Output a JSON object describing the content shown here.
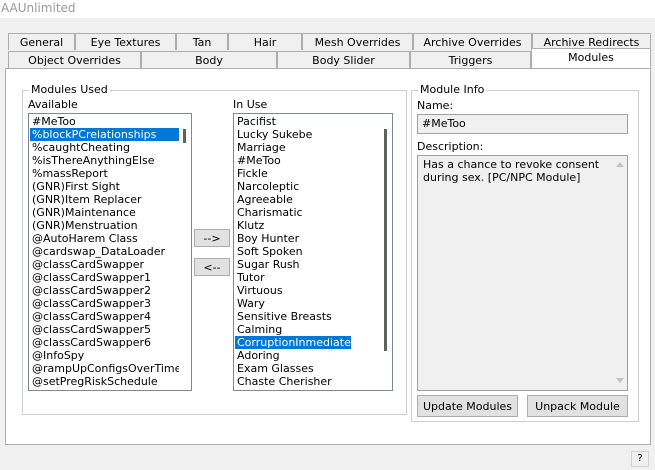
{
  "window": {
    "title": "AAUnlimited"
  },
  "tabs_row1": [
    "General",
    "Eye Textures",
    "Tan",
    "Hair",
    "Mesh Overrides",
    "Archive Overrides",
    "Archive Redirects"
  ],
  "tabs_row2": [
    "Object Overrides",
    "Body",
    "Body Slider",
    "Triggers",
    "Modules"
  ],
  "active_tab": "Modules",
  "modules_used": {
    "group_title": "Modules Used",
    "available_label": "Available",
    "in_use_label": "In Use",
    "available": [
      "#MeToo",
      "%blockPCrelationships",
      "%caughtCheating",
      "%isThereAnythingElse",
      "%massReport",
      "(GNR)First Sight",
      "(GNR)Item Replacer",
      "(GNR)Maintenance",
      "(GNR)Menstruation",
      "@AutoHarem Class",
      "@cardswap_DataLoader",
      "@classCardSwapper",
      "@classCardSwapper1",
      "@classCardSwapper2",
      "@classCardSwapper3",
      "@classCardSwapper4",
      "@classCardSwapper5",
      "@classCardSwapper6",
      "@InfoSpy",
      "@rampUpConfigsOverTime",
      "@setPregRiskSchedule"
    ],
    "available_selected": 1,
    "in_use": [
      "Pacifist",
      "Lucky Sukebe",
      "Marriage",
      "#MeToo",
      "Fickle",
      "Narcoleptic",
      "Agreeable",
      "Charismatic",
      "Klutz",
      "Boy Hunter",
      "Soft Spoken",
      "Sugar Rush",
      "Tutor",
      "Virtuous",
      "Wary",
      "Sensitive Breasts",
      "Calming",
      "CorruptionInmediate",
      "Adoring",
      "Exam Glasses",
      "Chaste Cherisher"
    ],
    "in_use_selected": 17,
    "add_button": "-->",
    "remove_button": "<--"
  },
  "module_info": {
    "group_title": "Module Info",
    "name_label": "Name:",
    "name_value": "#MeToo",
    "description_label": "Description:",
    "description_value": "Has a chance to revoke consent during sex. [PC/NPC Module]",
    "update_button": "Update Modules",
    "unpack_button": "Unpack Module"
  },
  "statusbar": {
    "help_button": "?"
  }
}
